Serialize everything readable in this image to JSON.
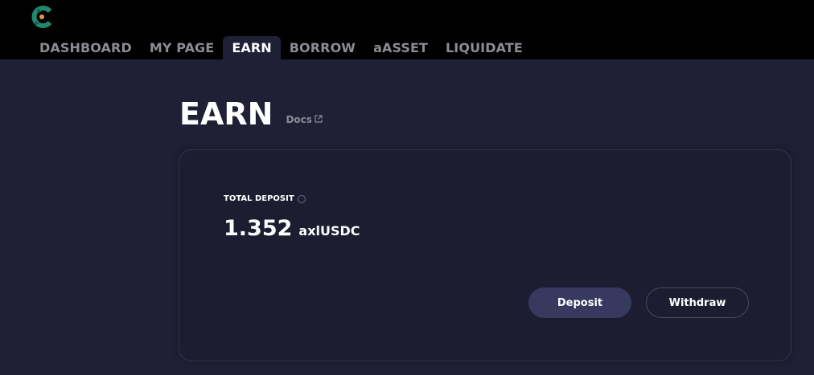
{
  "nav": {
    "tabs": [
      {
        "label": "DASHBOARD"
      },
      {
        "label": "MY PAGE"
      },
      {
        "label": "EARN"
      },
      {
        "label": "BORROW"
      },
      {
        "label": "aASSET"
      },
      {
        "label": "LIQUIDATE"
      }
    ],
    "active_tab": "EARN"
  },
  "page": {
    "title": "EARN",
    "docs_label": "Docs"
  },
  "card": {
    "total_deposit_label": "TOTAL DEPOSIT",
    "total_deposit_value": "1.352",
    "total_deposit_unit": "axlUSDC",
    "deposit_button": "Deposit",
    "withdraw_button": "Withdraw"
  },
  "colors": {
    "background": "#1f2036",
    "header": "#000000",
    "logo_green": "#1d8a6f",
    "logo_orange": "#e8914a",
    "accent_button": "#373a5e"
  },
  "icons": {
    "logo": "app-logo-icon",
    "docs": "external-link-icon",
    "info": "info-icon"
  }
}
